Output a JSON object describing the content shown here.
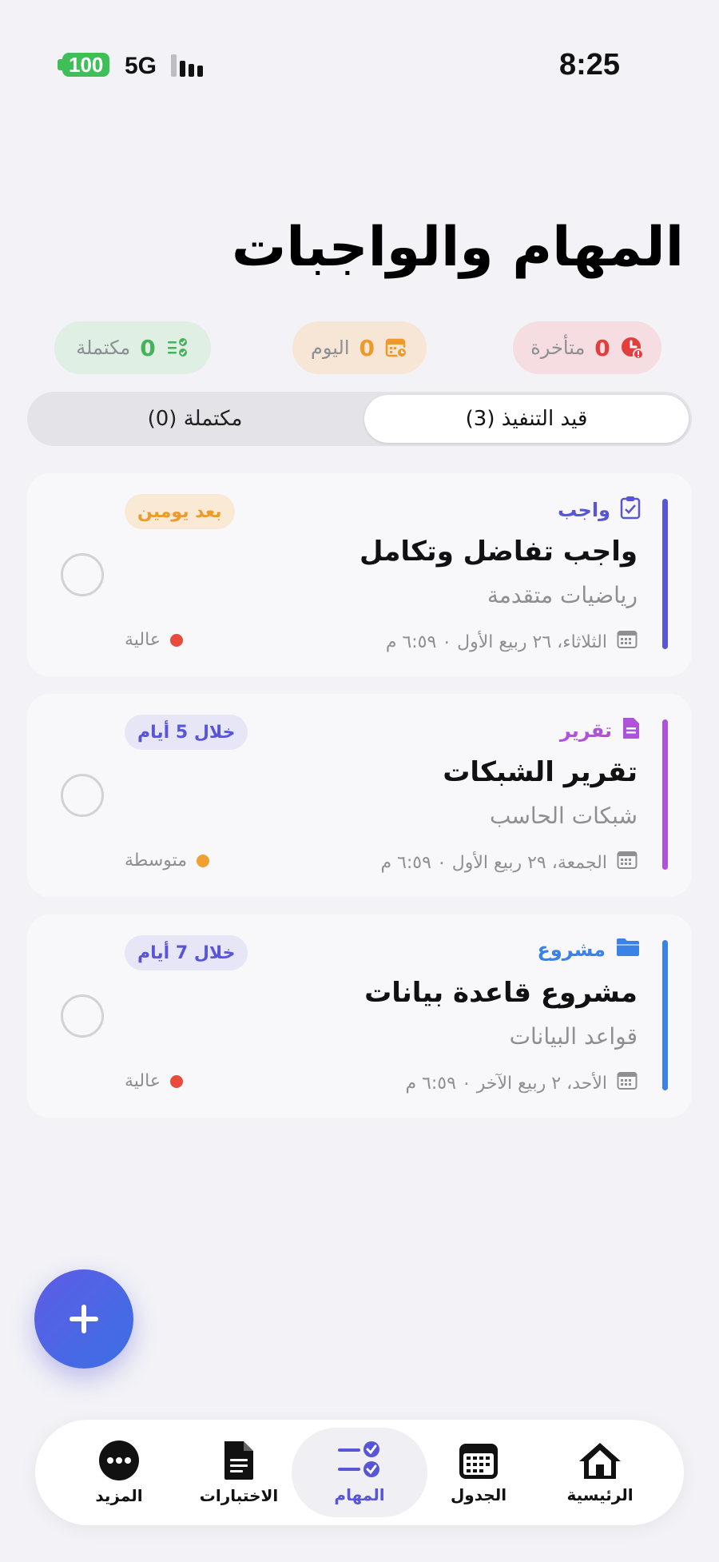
{
  "status_bar": {
    "battery": "100",
    "network": "5G",
    "time": "8:25"
  },
  "header": {
    "title": "المهام والواجبات"
  },
  "summary": {
    "overdue": {
      "count": "0",
      "label": "متأخرة"
    },
    "today": {
      "count": "0",
      "label": "اليوم"
    },
    "completed": {
      "count": "0",
      "label": "مكتملة"
    }
  },
  "segments": {
    "in_progress": "قيد التنفيذ (3)",
    "completed": "مكتملة (0)"
  },
  "tasks": [
    {
      "type": "واجب",
      "type_icon": "clipboard-check-icon",
      "title": "واجب تفاضل وتكامل",
      "course": "رياضيات متقدمة",
      "due": "الثلاثاء، ٢٦ ربيع الأول ٠ ٦:٥٩ م",
      "priority": "عالية",
      "badge": "بعد يومين",
      "accent": "#5856D6",
      "priority_color": "#E74C3C",
      "badge_bg": "#FAE9D4",
      "badge_color": "#EE9A2A"
    },
    {
      "type": "تقرير",
      "type_icon": "document-icon",
      "title": "تقرير الشبكات",
      "course": "شبكات الحاسب",
      "due": "الجمعة، ٢٩ ربيع الأول ٠ ٦:٥٩ م",
      "priority": "متوسطة",
      "badge": "خلال 5 أيام",
      "accent": "#AF52DE",
      "priority_color": "#F0A030",
      "badge_bg": "#E6E6F7",
      "badge_color": "#5856D6"
    },
    {
      "type": "مشروع",
      "type_icon": "folder-icon",
      "title": "مشروع قاعدة بيانات",
      "course": "قواعد البيانات",
      "due": "الأحد، ٢ ربيع الآخر ٠ ٦:٥٩ م",
      "priority": "عالية",
      "badge": "خلال 7 أيام",
      "accent": "#3B82E6",
      "priority_color": "#E74C3C",
      "badge_bg": "#E6E6F7",
      "badge_color": "#5856D6"
    }
  ],
  "tabbar": {
    "home": "الرئيسية",
    "schedule": "الجدول",
    "tasks": "المهام",
    "exams": "الاختبارات",
    "more": "المزيد"
  },
  "colors": {
    "background": "#F2F2F7",
    "primary": "#5856D6",
    "overdue": "#E33D3D",
    "today": "#EE9A2A",
    "completed": "#45B35A"
  }
}
